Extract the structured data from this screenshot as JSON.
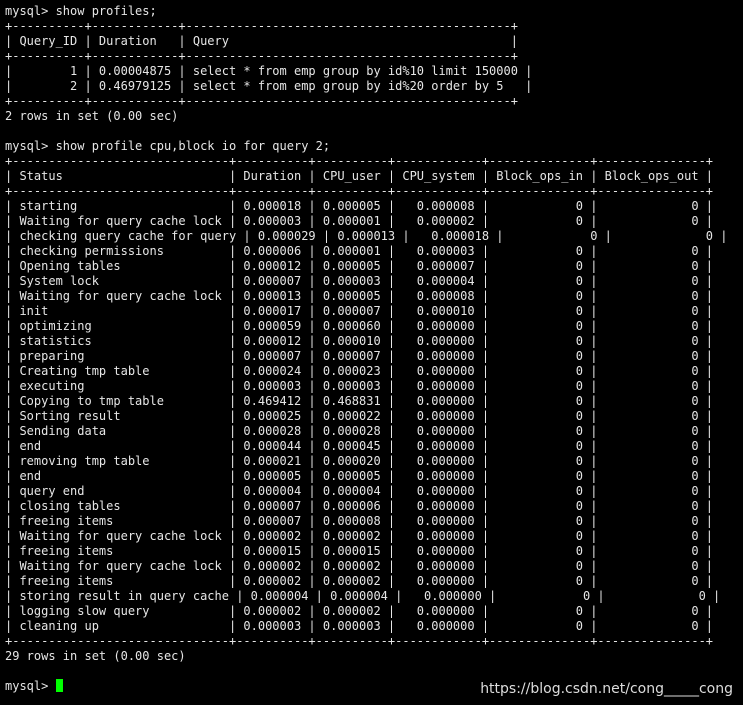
{
  "terminal": {
    "lines": [
      "mysql> show profiles;",
      "+----------+------------+---------------------------------------------+",
      "| Query_ID | Duration   | Query                                       |",
      "+----------+------------+---------------------------------------------+",
      "|        1 | 0.00004875 | select * from emp group by id%10 limit 150000 |",
      "|        2 | 0.46979125 | select * from emp group by id%20 order by 5   |",
      "+----------+------------+---------------------------------------------+",
      "2 rows in set (0.00 sec)",
      "",
      "mysql> show profile cpu,block io for query 2;",
      "+------------------------------+----------+----------+------------+--------------+---------------+",
      "| Status                       | Duration | CPU_user | CPU_system | Block_ops_in | Block_ops_out |",
      "+------------------------------+----------+----------+------------+--------------+---------------+",
      "| starting                     | 0.000018 | 0.000005 |   0.000008 |            0 |             0 |",
      "| Waiting for query cache lock | 0.000003 | 0.000001 |   0.000002 |            0 |             0 |",
      "| checking query cache for query | 0.000029 | 0.000013 |   0.000018 |            0 |             0 |",
      "| checking permissions         | 0.000006 | 0.000001 |   0.000003 |            0 |             0 |",
      "| Opening tables               | 0.000012 | 0.000005 |   0.000007 |            0 |             0 |",
      "| System lock                  | 0.000007 | 0.000003 |   0.000004 |            0 |             0 |",
      "| Waiting for query cache lock | 0.000013 | 0.000005 |   0.000008 |            0 |             0 |",
      "| init                         | 0.000017 | 0.000007 |   0.000010 |            0 |             0 |",
      "| optimizing                   | 0.000059 | 0.000060 |   0.000000 |            0 |             0 |",
      "| statistics                   | 0.000012 | 0.000010 |   0.000000 |            0 |             0 |",
      "| preparing                    | 0.000007 | 0.000007 |   0.000000 |            0 |             0 |",
      "| Creating tmp table           | 0.000024 | 0.000023 |   0.000000 |            0 |             0 |",
      "| executing                    | 0.000003 | 0.000003 |   0.000000 |            0 |             0 |",
      "| Copying to tmp table         | 0.469412 | 0.468831 |   0.000000 |            0 |             0 |",
      "| Sorting result               | 0.000025 | 0.000022 |   0.000000 |            0 |             0 |",
      "| Sending data                 | 0.000028 | 0.000028 |   0.000000 |            0 |             0 |",
      "| end                          | 0.000044 | 0.000045 |   0.000000 |            0 |             0 |",
      "| removing tmp table           | 0.000021 | 0.000020 |   0.000000 |            0 |             0 |",
      "| end                          | 0.000005 | 0.000005 |   0.000000 |            0 |             0 |",
      "| query end                    | 0.000004 | 0.000004 |   0.000000 |            0 |             0 |",
      "| closing tables               | 0.000007 | 0.000006 |   0.000000 |            0 |             0 |",
      "| freeing items                | 0.000007 | 0.000008 |   0.000000 |            0 |             0 |",
      "| Waiting for query cache lock | 0.000002 | 0.000002 |   0.000000 |            0 |             0 |",
      "| freeing items                | 0.000015 | 0.000015 |   0.000000 |            0 |             0 |",
      "| Waiting for query cache lock | 0.000002 | 0.000002 |   0.000000 |            0 |             0 |",
      "| freeing items                | 0.000002 | 0.000002 |   0.000000 |            0 |             0 |",
      "| storing result in query cache | 0.000004 | 0.000004 |   0.000000 |            0 |             0 |",
      "| logging slow query           | 0.000002 | 0.000002 |   0.000000 |            0 |             0 |",
      "| cleaning up                  | 0.000003 | 0.000003 |   0.000000 |            0 |             0 |",
      "+------------------------------+----------+----------+------------+--------------+---------------+",
      "29 rows in set (0.00 sec)",
      ""
    ],
    "prompt": "mysql> "
  },
  "watermark": "https://blog.csdn.net/cong_____cong",
  "colors": {
    "background": "#000000",
    "text": "#e6e6e6",
    "cursor": "#00ff00"
  }
}
